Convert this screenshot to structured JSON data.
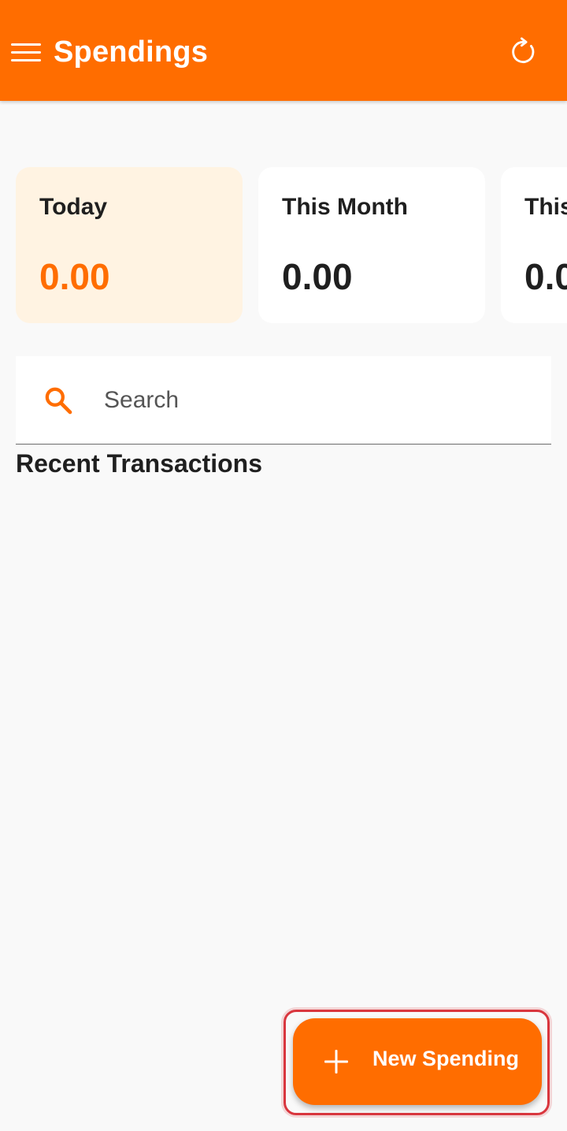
{
  "appbar": {
    "title": "Spendings",
    "menu_icon": "hamburger-menu-icon",
    "refresh_icon": "refresh-icon",
    "color": "#ff6d00"
  },
  "summary_cards": [
    {
      "label": "Today",
      "value": "0.00",
      "accent": "#ff6d00",
      "background": "#fff3e2"
    },
    {
      "label": "This Month",
      "value": "0.00"
    },
    {
      "label": "This",
      "value": "0.0"
    }
  ],
  "search": {
    "placeholder": "Search",
    "value": "",
    "icon": "search-icon"
  },
  "recent": {
    "title": "Recent Transactions",
    "items": []
  },
  "fab": {
    "label": "New Spending",
    "icon": "plus-icon",
    "color": "#ff6d00"
  }
}
